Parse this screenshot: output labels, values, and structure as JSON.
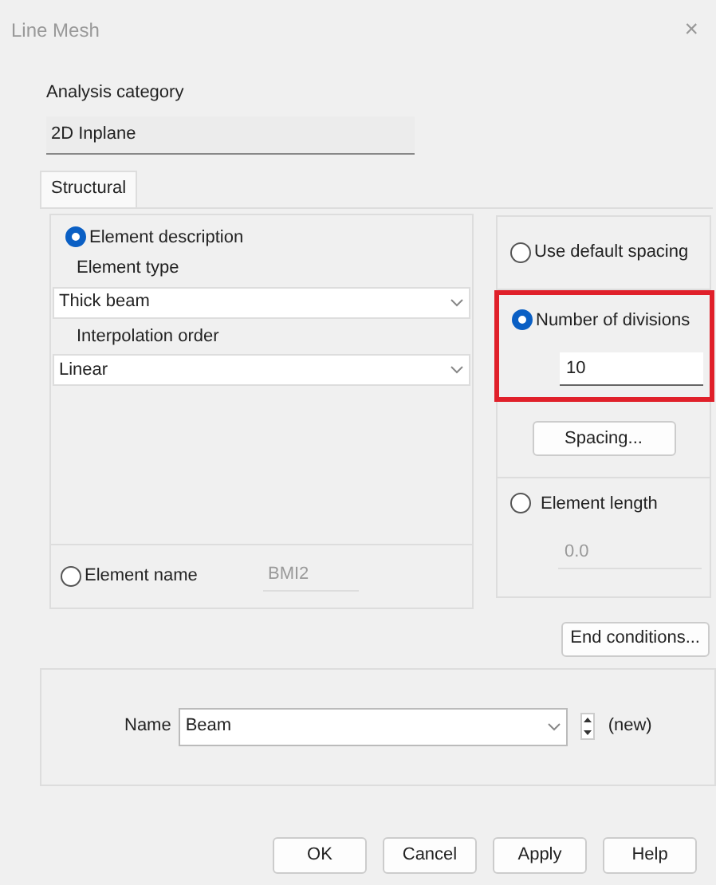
{
  "window": {
    "title": "Line Mesh",
    "close": "×"
  },
  "analysis_category": {
    "label": "Analysis category",
    "value": "2D Inplane"
  },
  "tabs": [
    {
      "label": "Structural",
      "selected": true
    }
  ],
  "element_description": {
    "label": "Element description",
    "selected": true,
    "element_type": {
      "label": "Element type",
      "value": "Thick beam"
    },
    "interpolation_order": {
      "label": "Interpolation order",
      "value": "Linear"
    }
  },
  "element_name": {
    "label": "Element name",
    "selected": false,
    "value": "BMI2",
    "disabled": true
  },
  "spacing_options": [
    {
      "kind": "radio",
      "label": "Use default spacing",
      "selected": false,
      "highlighted": false
    },
    {
      "kind": "radio_input",
      "label": "Number of divisions",
      "selected": true,
      "value": "10",
      "disabled": false,
      "highlighted": true
    },
    {
      "kind": "button",
      "label": "Spacing..."
    },
    {
      "kind": "radio_input",
      "label": "Element length",
      "selected": false,
      "value": "0.0",
      "disabled": true,
      "highlighted": false
    }
  ],
  "end_conditions_button": "End conditions...",
  "name_group": {
    "label": "Name",
    "value": "Beam",
    "status": "(new)"
  },
  "buttons": [
    "OK",
    "Cancel",
    "Apply",
    "Help"
  ]
}
